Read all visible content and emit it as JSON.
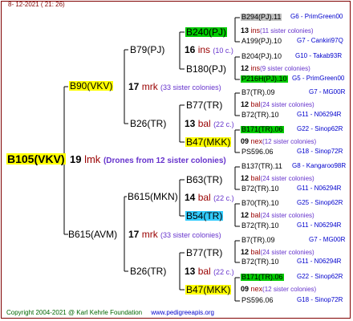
{
  "header": {
    "date": "8- 12-2021 ( 21: 26)"
  },
  "footer": {
    "copyright": "Copyright 2004-2021 @ Karl Kehrle Foundation",
    "url": "www.pedigreeapis.org"
  },
  "root": {
    "name": "B105(VKV)",
    "num": "19",
    "code": "lmk",
    "note": "(Drones from 12 sister colonies)"
  },
  "level1": [
    {
      "name": "B90(VKV)",
      "num": "17",
      "code": "mrk",
      "note": "(33 sister colonies)"
    },
    {
      "name": "B615(AVM)",
      "num": "17",
      "code": "mrk",
      "note": "(33 sister colonies)"
    }
  ],
  "level2": [
    {
      "name": "B79(PJ)",
      "num": "16",
      "code": "ins",
      "note": "(10 c.)"
    },
    {
      "name": "B26(TR)",
      "num": "13",
      "code": "bal",
      "note": "(22 c.)"
    },
    {
      "name": "B615(MKN)",
      "num": "14",
      "code": "bal",
      "note": "(22 c.)"
    },
    {
      "name": "B26(TR)",
      "num": "13",
      "code": "bal",
      "note": "(22 c.)"
    }
  ],
  "level3": [
    {
      "name": "B240(PJ)"
    },
    {
      "name": "B180(PJ)"
    },
    {
      "name": "B77(TR)"
    },
    {
      "name": "B47(MKK)"
    },
    {
      "name": "B63(TR)"
    },
    {
      "name": "B54(TR)"
    },
    {
      "name": "B77(TR)"
    },
    {
      "name": "B47(MKK)"
    }
  ],
  "level3_mid": [
    {
      "num": "13",
      "code": "ins",
      "note": "(11 sister colonies)"
    },
    {
      "num": "12",
      "code": "ins",
      "note": "(9 sister colonies)"
    },
    {
      "num": "12",
      "code": "bal",
      "note": "(24 sister colonies)"
    },
    {
      "num": "09",
      "code": "nex",
      "note": "(12 sister colonies)"
    },
    {
      "num": "12",
      "code": "bal",
      "note": "(24 sister colonies)"
    },
    {
      "num": "12",
      "code": "bal",
      "note": "(24 sister colonies)"
    },
    {
      "num": "12",
      "code": "bal",
      "note": "(24 sister colonies)"
    },
    {
      "num": "09",
      "code": "nex",
      "note": "(12 sister colonies)"
    }
  ],
  "level4": [
    {
      "name": "B294(PJ).11",
      "desc": "G6 - PrimGreen00"
    },
    {
      "name": "A199(PJ).10",
      "desc": "G7 - Cankiri97Q"
    },
    {
      "name": "B204(PJ).10",
      "desc": "G10 - Takab93R"
    },
    {
      "name": "P216H(PJ).10",
      "desc": "G5 - PrimGreen00"
    },
    {
      "name": "B7(TR).09",
      "desc": "G7 - MG00R"
    },
    {
      "name": "B72(TR).10",
      "desc": "G11 - N06294R"
    },
    {
      "name": "B171(TR).06",
      "desc": "G22 - Sinop62R"
    },
    {
      "name": "PS596.06",
      "desc": "G18 - Sinop72R"
    },
    {
      "name": "B137(TR).11",
      "desc": "G8 - Kangaroo98R"
    },
    {
      "name": "B72(TR).10",
      "desc": "G11 - N06294R"
    },
    {
      "name": "B70(TR).10",
      "desc": "G25 - Sinop62R"
    },
    {
      "name": "B72(TR).10",
      "desc": "G11 - N06294R"
    },
    {
      "name": "B7(TR).09",
      "desc": "G7 - MG00R"
    },
    {
      "name": "B72(TR).10",
      "desc": "G11 - N06294R"
    },
    {
      "name": "B171(TR).06",
      "desc": "G22 - Sinop62R"
    },
    {
      "name": "PS596.06",
      "desc": "G18 - Sinop72R"
    }
  ],
  "colors": {
    "yellow": "#ffff00",
    "green": "#00cc00",
    "cyan": "#33ccff",
    "grey": "#c0c0c0",
    "line": "#000000",
    "border": "#800000"
  }
}
